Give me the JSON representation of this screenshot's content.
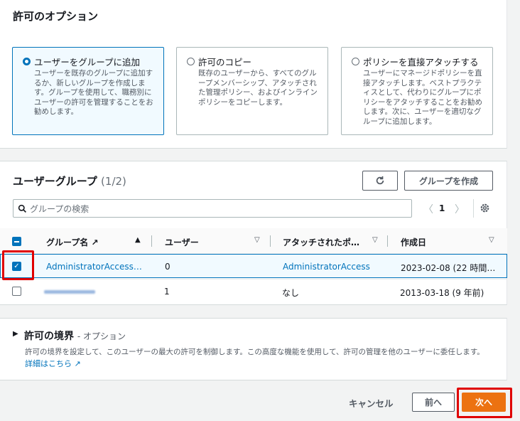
{
  "options_section": {
    "title": "許可のオプション",
    "tiles": [
      {
        "title": "ユーザーをグループに追加",
        "desc": "ユーザーを既存のグループに追加するか、新しいグループを作成します。グループを使用して、職務別にユーザーの許可を管理することをお勧めします。",
        "selected": true
      },
      {
        "title": "許可のコピー",
        "desc": "既存のユーザーから、すべてのグループメンバーシップ、アタッチされた管理ポリシー、およびインラインポリシーをコピーします。",
        "selected": false
      },
      {
        "title": "ポリシーを直接アタッチする",
        "desc": "ユーザーにマネージドポリシーを直接アタッチします。ベストプラクティスとして、代わりにグループにポリシーをアタッチすることをお勧めします。次に、ユーザーを適切なグループに追加します。",
        "selected": false
      }
    ]
  },
  "groups_section": {
    "title": "ユーザーグループ",
    "count": "(1/2)",
    "refresh_icon": "refresh-icon",
    "create_label": "グループを作成",
    "search_placeholder": "グループの検索",
    "page": "1",
    "columns": [
      "グループ名",
      "ユーザー",
      "アタッチされたポ…",
      "作成日"
    ],
    "rows": [
      {
        "name": "AdministratorAccess…",
        "users": "0",
        "policies": "AdministratorAccess",
        "created": "2023-02-08 (22 時間…",
        "checked": true
      },
      {
        "name": "",
        "users": "1",
        "policies": "なし",
        "created": "2013-03-18 (9 年前)",
        "checked": false
      }
    ]
  },
  "boundary_section": {
    "title": "許可の境界",
    "suffix": "- オプション",
    "desc": "許可の境界を設定して、このユーザーの最大の許可を制御します。この高度な機能を使用して、許可の管理を他のユーザーに委任します。",
    "learn_more": "詳細はこちら"
  },
  "footer": {
    "cancel": "キャンセル",
    "prev": "前へ",
    "next": "次へ"
  },
  "colors": {
    "primary": "#ec7211",
    "link": "#0073bb",
    "highlight": "#e00000"
  }
}
